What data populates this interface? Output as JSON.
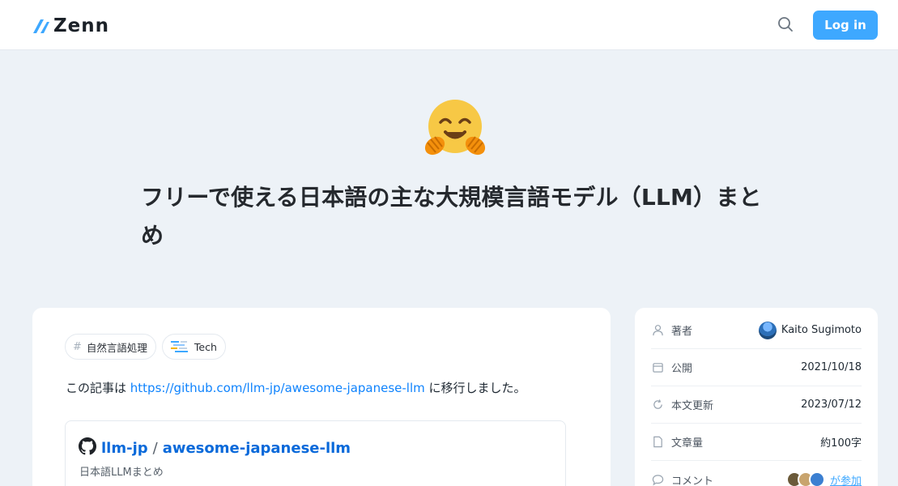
{
  "header": {
    "logo_text": "Zenn",
    "login_label": "Log in"
  },
  "article": {
    "emoji": "🤗",
    "title": "フリーで使える日本語の主な大規模言語モデル（LLM）まとめ",
    "topics": [
      {
        "icon": "hash-icon",
        "label": "自然言語処理"
      },
      {
        "icon": "tech-icon",
        "label": "Tech"
      }
    ],
    "intro_prefix": "この記事は ",
    "intro_link": "https://github.com/llm-jp/awesome-japanese-llm",
    "intro_suffix": " に移行しました。",
    "embed": {
      "owner": "llm-jp",
      "separator": "/",
      "repo": "awesome-japanese-llm",
      "description": "日本語LLMまとめ"
    }
  },
  "sidebar": {
    "author": {
      "label": "著者",
      "value": "Kaito Sugimoto"
    },
    "published": {
      "label": "公開",
      "value": "2021/10/18"
    },
    "updated": {
      "label": "本文更新",
      "value": "2023/07/12"
    },
    "length": {
      "label": "文章量",
      "value": "約100字"
    },
    "comments": {
      "label": "コメント",
      "value": "が参加"
    }
  },
  "colors": {
    "accent": "#3ea8ff",
    "link": "#0f83fd",
    "background": "#edf2f7"
  }
}
